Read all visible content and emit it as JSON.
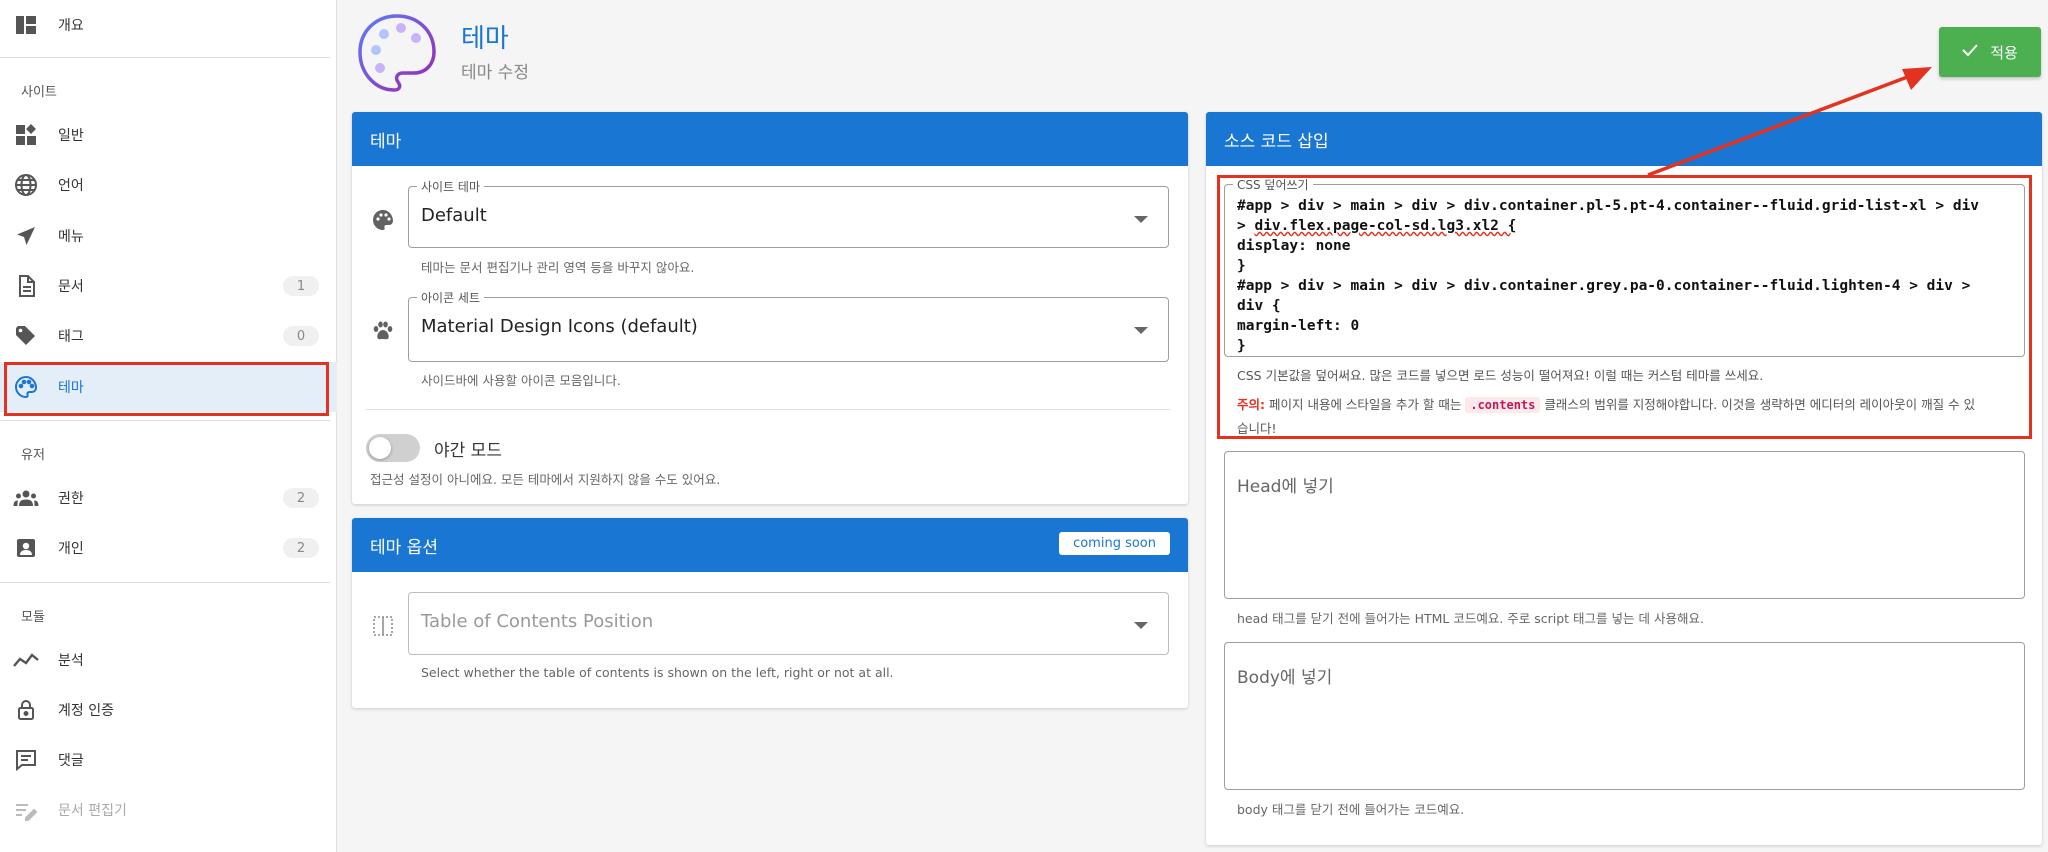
{
  "sidebar": {
    "items": [
      {
        "key": "overview",
        "label": "개요",
        "icon": "dashboard-icon"
      },
      {
        "key": "general",
        "label": "일반",
        "icon": "widgets-icon"
      },
      {
        "key": "language",
        "label": "언어",
        "icon": "globe-icon"
      },
      {
        "key": "menu",
        "label": "메뉴",
        "icon": "navigation-icon"
      },
      {
        "key": "documents",
        "label": "문서",
        "count": "1",
        "icon": "document-icon"
      },
      {
        "key": "tags",
        "label": "태그",
        "count": "0",
        "icon": "tag-icon"
      },
      {
        "key": "theme",
        "label": "테마",
        "icon": "palette-icon"
      },
      {
        "key": "permissions",
        "label": "권한",
        "count": "2",
        "icon": "people-icon"
      },
      {
        "key": "personal",
        "label": "개인",
        "count": "2",
        "icon": "account-box-icon"
      },
      {
        "key": "analytics",
        "label": "분석",
        "icon": "chart-line-icon"
      },
      {
        "key": "auth",
        "label": "계정 인증",
        "icon": "lock-icon"
      },
      {
        "key": "comments",
        "label": "댓글",
        "icon": "comment-icon"
      },
      {
        "key": "editor",
        "label": "문서 편집기",
        "icon": "edit-lines-icon"
      }
    ],
    "sections": {
      "site": "사이트",
      "users": "유저",
      "modules": "모듈"
    }
  },
  "header": {
    "title": "테마",
    "subtitle": "테마 수정",
    "apply_label": "적용",
    "accent": "#1976d2",
    "apply_color": "#4caf50"
  },
  "theme_card": {
    "title": "테마",
    "site_theme_label": "사이트 테마",
    "site_theme_value": "Default",
    "site_theme_hint": "테마는 문서 편집기나 관리 영역 등을 바꾸지 않아요.",
    "icon_set_label": "아이콘 세트",
    "icon_set_value": "Material Design Icons (default)",
    "icon_set_hint": "사이드바에 사용할 아이콘 모음입니다.",
    "dark_mode_label": "야간 모드",
    "dark_mode_hint": "접근성 설정이 아니에요. 모든 테마에서 지원하지 않을 수도 있어요."
  },
  "options_card": {
    "title": "테마 옵션",
    "badge": "coming soon",
    "toc_placeholder": "Table of Contents Position",
    "toc_hint": "Select whether the table of contents is shown on the left, right or not at all."
  },
  "code_card": {
    "title": "소스 코드 삽입",
    "css_label": "CSS 덮어쓰기",
    "css_lines": [
      "#app > div > main > div > div.container.pl-5.pt-4.container--fluid.grid-list-xl > div",
      "div.flex.page-col-sd.lg3.xl2 {",
      "display: none",
      "}",
      "#app > div > main > div > div.container.grey.pa-0.container--fluid.lighten-4 > div >",
      "div {",
      "margin-left: 0",
      "}"
    ],
    "css_hint": "CSS 기본값을 덮어써요. 많은 코드를 넣으면 로드 성능이 떨어져요! 이럴 때는 커스텀 테마를 쓰세요.",
    "warn_label": "주의:",
    "warn_text_1": "페이지 내용에 스타일을 추가 할 때는",
    "warn_code": ".contents",
    "warn_text_2": "클래스의 범위를 지정해야합니다. 이것을 생략하면 에디터의 레이아웃이 깨질 수 있",
    "warn_text_3": "습니다!",
    "head_placeholder": "Head에 넣기",
    "head_hint": "head 태그를 닫기 전에 들어가는 HTML 코드예요. 주로 script 태그를 넣는 데 사용해요.",
    "body_placeholder": "Body에 넣기",
    "body_hint": "body 태그를 닫기 전에 들어가는 코드예요."
  }
}
